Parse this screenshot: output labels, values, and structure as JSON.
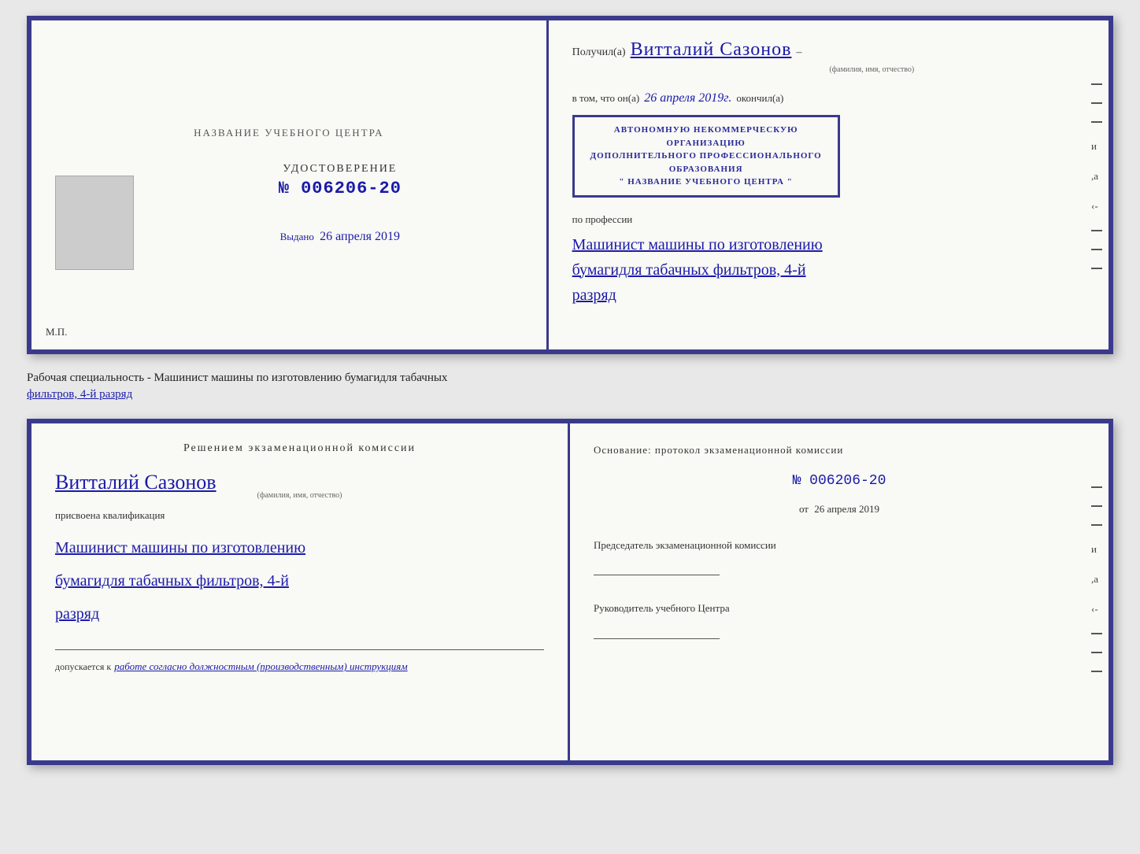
{
  "topCert": {
    "leftSide": {
      "schoolNamePlaceholder": "НАЗВАНИЕ УЧЕБНОГО ЦЕНТРА",
      "udostoverenie": "УДОСТОВЕРЕНИЕ",
      "number": "№ 006206-20",
      "vydano": "Выдано",
      "vydanoDate": "26 апреля 2019",
      "mpLabel": "М.П."
    },
    "rightSide": {
      "poluchilLabel": "Получил(а)",
      "handwrittenName": "Витталий Сазонов",
      "fioSubtitle": "(фамилия, имя, отчество)",
      "dash1": "–",
      "vtomLabel": "в том, что он(а)",
      "handwrittenDate": "26 апреля 2019г.",
      "okonchilLabel": "окончил(а)",
      "stampLine1": "АВТОНОМНУЮ НЕКОММЕРЧЕСКУЮ ОРГАНИЗАЦИЮ",
      "stampLine2": "ДОПОЛНИТЕЛЬНОГО ПРОФЕССИОНАЛЬНОГО ОБРАЗОВАНИЯ",
      "stampLine3": "\" НАЗВАНИЕ УЧЕБНОГО ЦЕНТРА \"",
      "poProfessiiLabel": "по профессии",
      "handwrittenProfession1": "Машинист машины по изготовлению",
      "handwrittenProfession2": "бумагидля табачных фильтров, 4-й",
      "handwrittenProfession3": "разряд"
    }
  },
  "specialtyLine": {
    "text": "Рабочая специальность - Машинист машины по изготовлению бумагидля табачных",
    "underlinedText": "фильтров, 4-й разряд"
  },
  "bottomCert": {
    "leftSide": {
      "resheniyemTitle": "Решением  экзаменационной  комиссии",
      "handwrittenName": "Витталий Сазонов",
      "fioSubtitle": "(фамилия, имя, отчество)",
      "prisvoyenaLabel": "присвоена квалификация",
      "profession1": "Машинист машины по изготовлению",
      "profession2": "бумагидля табачных фильтров, 4-й",
      "profession3": "разряд",
      "dopuskaetsyaLabel": "допускается к",
      "dopuskaetsyaText": "работе согласно должностным (производственным) инструкциям"
    },
    "rightSide": {
      "osnovanieTitleLabel": "Основание: протокол экзаменационной  комиссии",
      "protocolNumber": "№  006206-20",
      "otLabel": "от",
      "otDate": "26 апреля 2019",
      "predsedatelLabel": "Председатель экзаменационной комиссии",
      "rukovoditelLabel": "Руководитель учебного Центра"
    }
  }
}
